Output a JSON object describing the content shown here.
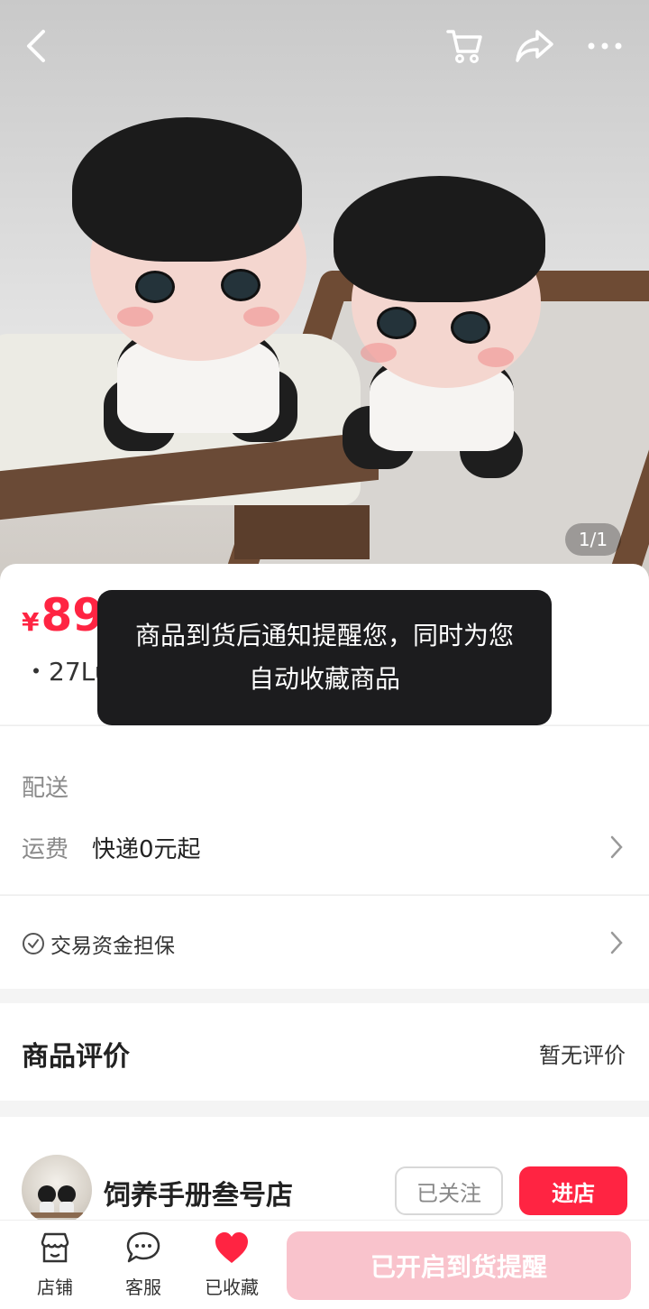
{
  "image_counter": "1/1",
  "price": {
    "currency": "¥",
    "value": "89"
  },
  "tags_text": "・27Lu x 11Mu・运动全套史",
  "delivery": {
    "section_title": "配送",
    "fee_label": "运费",
    "fee_value": "快递0元起"
  },
  "guarantee_text": "交易资金担保",
  "review": {
    "title": "商品评价",
    "value": "暂无评价"
  },
  "shop": {
    "name": "饲养手册叁号店",
    "follow_label": "已关注",
    "enter_label": "进店"
  },
  "bottom_bar": {
    "store_label": "店铺",
    "service_label": "客服",
    "fav_label": "已收藏",
    "remind_label": "已开启到货提醒"
  },
  "toast": "商品到货后通知提醒您，同时为您自动收藏商品",
  "colors": {
    "accent": "#ff2442",
    "remind_bg": "#f9c3cc",
    "toast_bg": "#1c1c1e"
  },
  "icons": [
    "back-icon",
    "cart-icon",
    "share-icon",
    "more-icon",
    "check-circle-icon",
    "chevron-right-icon",
    "store-icon",
    "chat-icon",
    "heart-icon"
  ]
}
